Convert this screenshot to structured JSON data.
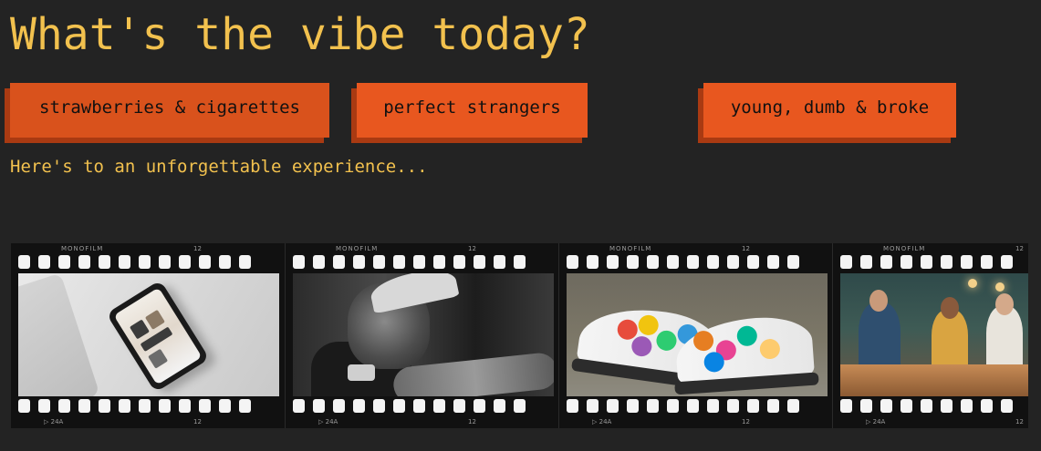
{
  "headline": "What's the vibe today?",
  "vibes": [
    {
      "label": "strawberries & cigarettes"
    },
    {
      "label": "perfect strangers"
    },
    {
      "label": "young, dumb & broke"
    }
  ],
  "tagline": "Here's to an unforgettable experience...",
  "filmstrip": {
    "brand": "MONOFILM",
    "frame_number": "12",
    "arrow_label": "24A",
    "frames": [
      {
        "photo": "phone-on-desk-photo"
      },
      {
        "photo": "tattoo-artist-photo"
      },
      {
        "photo": "painted-sneakers-photo"
      },
      {
        "photo": "kitchen-party-photo"
      }
    ]
  },
  "colors": {
    "background": "#232323",
    "accent_text": "#f2c14e",
    "button": "#e8571f",
    "button_shadow": "#a93a12"
  }
}
